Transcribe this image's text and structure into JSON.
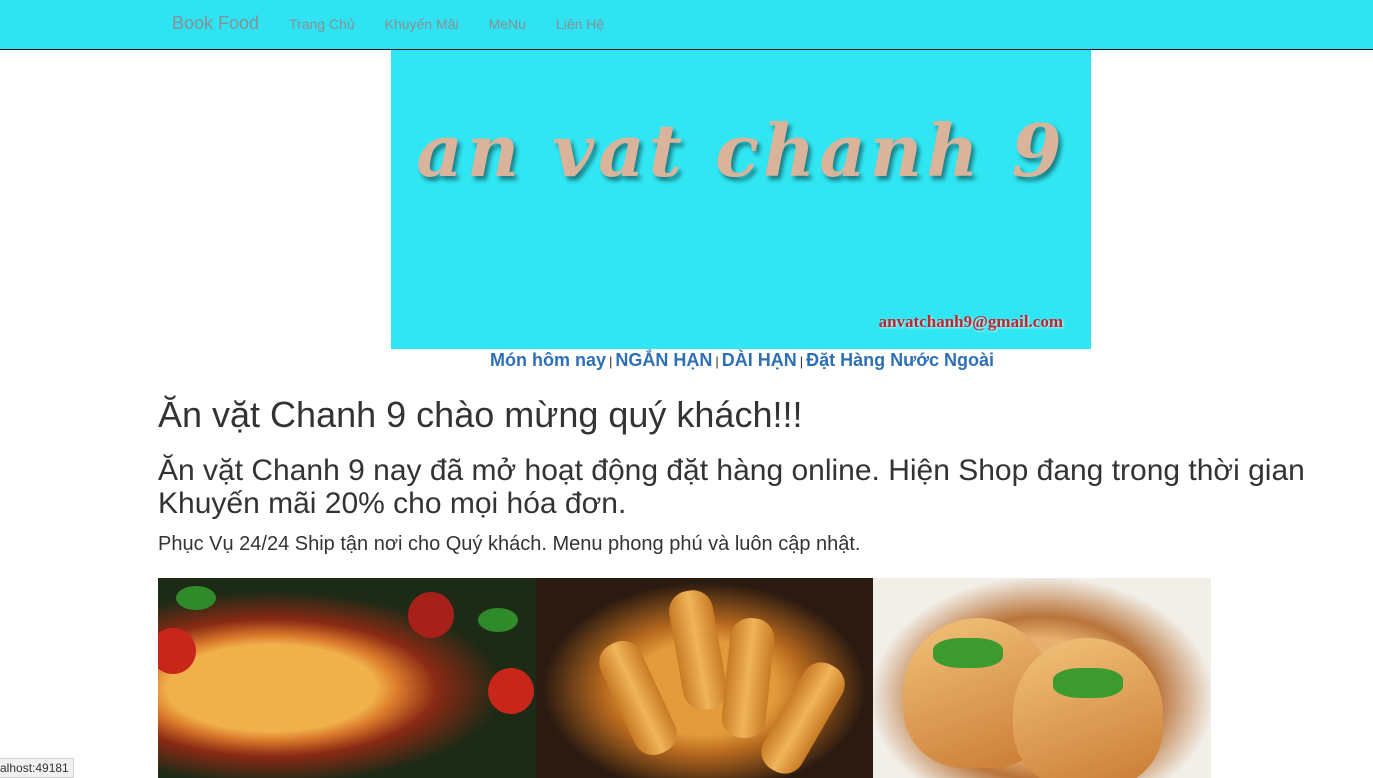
{
  "navbar": {
    "brand": "Book Food",
    "links": [
      "Trang Chủ",
      "Khuyến Mãi",
      "MeNu",
      "Liên Hệ"
    ]
  },
  "banner": {
    "title": "an vat chanh 9",
    "email": "anvatchanh9@gmail.com"
  },
  "sublinks": [
    "Món hôm nay",
    "NGẮN HẠN",
    "DÀI HẠN",
    "Đặt Hàng Nước Ngoài"
  ],
  "sublink_separator": "|",
  "content": {
    "welcome": "Ăn vặt Chanh 9 chào mừng quý khách!!!",
    "subheading": "Ăn vặt Chanh 9 nay đã mở hoạt động đặt hàng online. Hiện Shop đang trong thời gian Khuyến mãi 20% cho mọi hóa đơn.",
    "lead": "Phục Vụ 24/24 Ship tận nơi cho Quý khách. Menu phong phú và luôn cập nhật."
  },
  "status_bar": "alhost:49181",
  "colors": {
    "navbar": "#2fe3f2",
    "banner": "#30e6f3",
    "link": "#2f6fb5",
    "email": "#c0242f"
  }
}
